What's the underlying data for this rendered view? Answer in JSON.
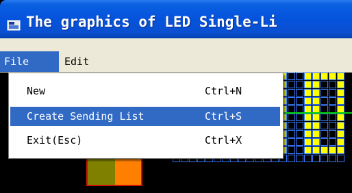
{
  "window": {
    "title": "The graphics of LED Single-Li",
    "app_icon": "led-app-icon"
  },
  "menubar": {
    "file_label": "File",
    "edit_label": "Edit"
  },
  "file_menu": {
    "items": [
      {
        "label": "New",
        "shortcut": "Ctrl+N"
      },
      {
        "label": "Create Sending List",
        "shortcut": "Ctrl+S"
      },
      {
        "label": "Exit(Esc)",
        "shortcut": "Ctrl+X"
      }
    ],
    "highlighted_index": 1
  },
  "colors": {
    "titlebar": "#0553dc",
    "menu_highlight": "#316ac5",
    "led_on": "#ffff00",
    "led_grid": "#3a7dff",
    "swatch_1": "#808000",
    "swatch_2": "#ff7f00"
  }
}
